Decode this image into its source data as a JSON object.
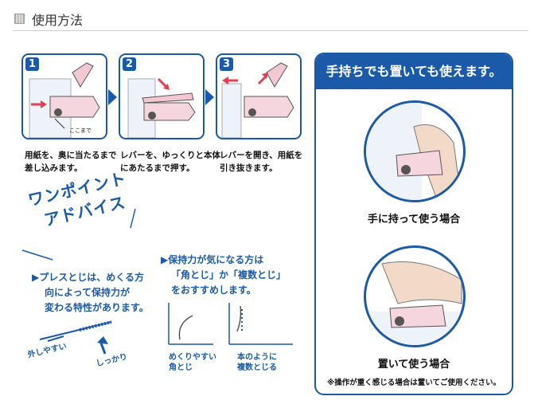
{
  "header": {
    "title": "使用方法"
  },
  "steps": [
    {
      "num": "1",
      "caption_l1": "用紙を、奥に当たるまで",
      "caption_l2": "差し込みます。",
      "inner_label": "ここまで"
    },
    {
      "num": "2",
      "caption_l1": "レバーを、ゆっくりと本体",
      "caption_l2": "にあたるまで押す。"
    },
    {
      "num": "3",
      "caption_l1": "レバーを開き、用紙を",
      "caption_l2": "引き抜きます。"
    }
  ],
  "advice": {
    "title_l1": "ワンポイント",
    "title_l2": "アドバイス",
    "tip1": {
      "l1": "▶プレスとじは、めくる方",
      "l2": "向によって保持力が",
      "l3": "変わる特性があります。"
    },
    "tip1_labels": {
      "left": "外しやすい",
      "right": "しっかり"
    },
    "tip2": {
      "l1": "▶保持力が気になる方は",
      "l2": "「角とじ」か「複数とじ」",
      "l3": "をおすすめします。"
    },
    "tip2_labels": {
      "a1": "めくりやすい",
      "a2": "角とじ",
      "b1": "本のように",
      "b2": "複数とじる"
    }
  },
  "panel": {
    "title": "手持ちでも置いても使えます。",
    "label_hand": "手に持って使う場合",
    "label_place": "置いて使う場合",
    "note": "※操作が重く感じる場合は置いてご使用ください。"
  }
}
